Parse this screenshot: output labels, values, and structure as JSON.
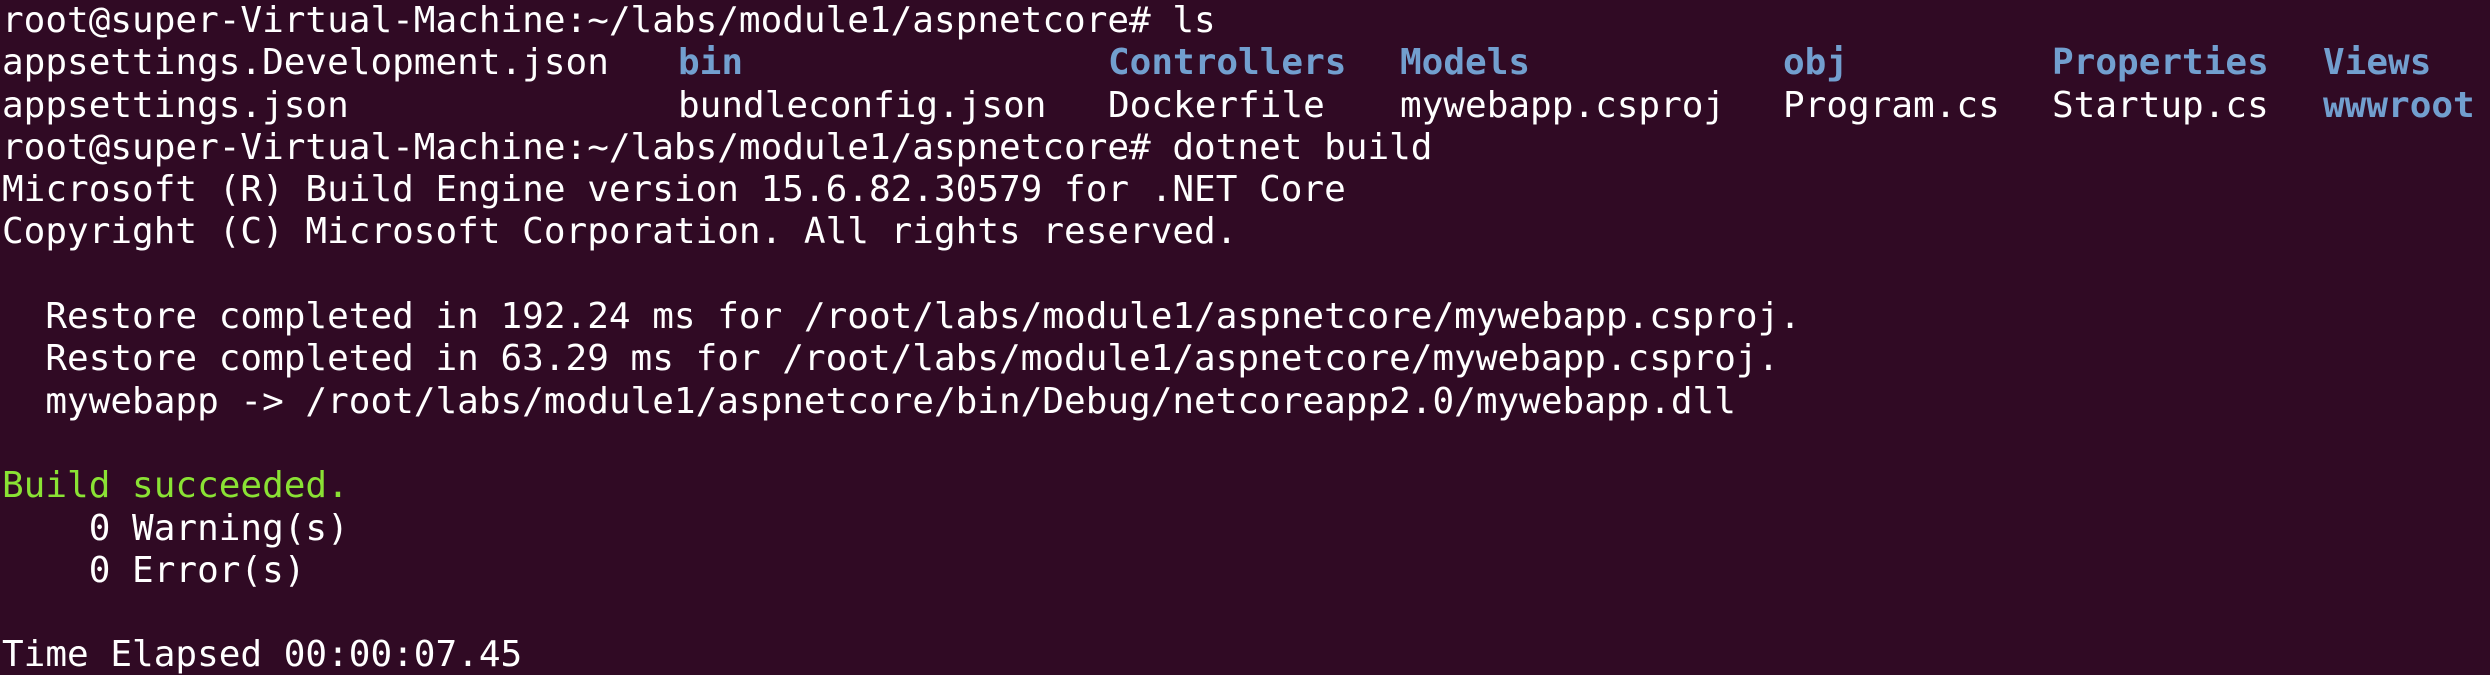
{
  "colors": {
    "background": "#300a24",
    "text": "#ffffff",
    "directory": "#729fcf",
    "success": "#8ae234"
  },
  "prompt1": "root@super-Virtual-Machine:~/labs/module1/aspnetcore# ls",
  "ls": {
    "row1": [
      {
        "name": "appsettings.Development.json",
        "type": "file"
      },
      {
        "name": "bin",
        "type": "dir"
      },
      {
        "name": "Controllers",
        "type": "dir"
      },
      {
        "name": "Models",
        "type": "dir"
      },
      {
        "name": "obj",
        "type": "dir"
      },
      {
        "name": "Properties",
        "type": "dir"
      },
      {
        "name": "Views",
        "type": "dir"
      }
    ],
    "row2": [
      {
        "name": "appsettings.json",
        "type": "file"
      },
      {
        "name": "bundleconfig.json",
        "type": "file"
      },
      {
        "name": "Dockerfile",
        "type": "file"
      },
      {
        "name": "mywebapp.csproj",
        "type": "file"
      },
      {
        "name": "Program.cs",
        "type": "file"
      },
      {
        "name": "Startup.cs",
        "type": "file"
      },
      {
        "name": "wwwroot",
        "type": "dir"
      }
    ]
  },
  "prompt2": "root@super-Virtual-Machine:~/labs/module1/aspnetcore# dotnet build",
  "build": {
    "engine": "Microsoft (R) Build Engine version 15.6.82.30579 for .NET Core",
    "copyright": "Copyright (C) Microsoft Corporation. All rights reserved.",
    "restore1": "  Restore completed in 192.24 ms for /root/labs/module1/aspnetcore/mywebapp.csproj.",
    "restore2": "  Restore completed in 63.29 ms for /root/labs/module1/aspnetcore/mywebapp.csproj.",
    "output": "  mywebapp -> /root/labs/module1/aspnetcore/bin/Debug/netcoreapp2.0/mywebapp.dll",
    "succeeded": "Build succeeded.",
    "warnings": "    0 Warning(s)",
    "errors": "    0 Error(s)",
    "elapsed": "Time Elapsed 00:00:07.45"
  }
}
